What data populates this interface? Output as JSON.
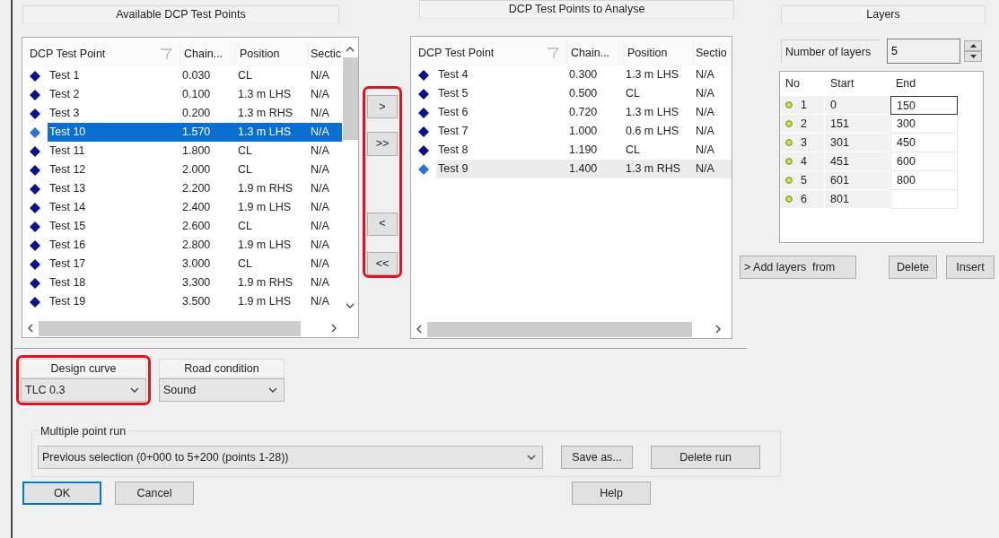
{
  "available": {
    "title": "Available DCP Test Points",
    "columns": [
      "DCP Test Point",
      "Chain...",
      "Position",
      "Sectic"
    ],
    "rows": [
      {
        "name": "Test 1",
        "chainage": "0.030",
        "position": "CL",
        "section": "N/A",
        "selected": false
      },
      {
        "name": "Test 2",
        "chainage": "0.100",
        "position": "1.3 m LHS",
        "section": "N/A",
        "selected": false
      },
      {
        "name": "Test 3",
        "chainage": "0.200",
        "position": "1.3 m RHS",
        "section": "N/A",
        "selected": false
      },
      {
        "name": "Test 10",
        "chainage": "1.570",
        "position": "1.3 m LHS",
        "section": "N/A",
        "selected": true
      },
      {
        "name": "Test 11",
        "chainage": "1.800",
        "position": "CL",
        "section": "N/A",
        "selected": false
      },
      {
        "name": "Test 12",
        "chainage": "2.000",
        "position": "CL",
        "section": "N/A",
        "selected": false
      },
      {
        "name": "Test 13",
        "chainage": "2.200",
        "position": "1.9 m RHS",
        "section": "N/A",
        "selected": false
      },
      {
        "name": "Test 14",
        "chainage": "2.400",
        "position": "1.9 m LHS",
        "section": "N/A",
        "selected": false
      },
      {
        "name": "Test 15",
        "chainage": "2.600",
        "position": "CL",
        "section": "N/A",
        "selected": false
      },
      {
        "name": "Test 16",
        "chainage": "2.800",
        "position": "1.9 m LHS",
        "section": "N/A",
        "selected": false
      },
      {
        "name": "Test 17",
        "chainage": "3.000",
        "position": "CL",
        "section": "N/A",
        "selected": false
      },
      {
        "name": "Test 18",
        "chainage": "3.300",
        "position": "1.9 m RHS",
        "section": "N/A",
        "selected": false
      },
      {
        "name": "Test 19",
        "chainage": "3.500",
        "position": "1.9 m LHS",
        "section": "N/A",
        "selected": false
      }
    ]
  },
  "transfer_buttons": {
    "highlighted": true,
    "buttons": [
      ">",
      ">>",
      "<",
      "<<"
    ]
  },
  "to_analyse": {
    "title": "DCP Test Points to Analyse",
    "columns": [
      "DCP Test Point",
      "Chain...",
      "Position",
      "Sectio"
    ],
    "rows": [
      {
        "name": "Test 4",
        "chainage": "0.300",
        "position": "1.3 m LHS",
        "section": "N/A",
        "selected": false
      },
      {
        "name": "Test 5",
        "chainage": "0.500",
        "position": "CL",
        "section": "N/A",
        "selected": false
      },
      {
        "name": "Test 6",
        "chainage": "0.720",
        "position": "1.3 m LHS",
        "section": "N/A",
        "selected": false
      },
      {
        "name": "Test 7",
        "chainage": "1.000",
        "position": "0.6 m LHS",
        "section": "N/A",
        "selected": false
      },
      {
        "name": "Test 8",
        "chainage": "1.190",
        "position": "CL",
        "section": "N/A",
        "selected": false
      },
      {
        "name": "Test 9",
        "chainage": "1.400",
        "position": "1.3 m RHS",
        "section": "N/A",
        "selected": true
      }
    ]
  },
  "layers": {
    "title": "Layers",
    "count_label": "Number of layers",
    "count": "5",
    "columns": [
      "No",
      "Start",
      "End"
    ],
    "rows": [
      {
        "no": "1",
        "start": "0",
        "end": "150",
        "editing": true
      },
      {
        "no": "2",
        "start": "151",
        "end": "300",
        "editing": false
      },
      {
        "no": "3",
        "start": "301",
        "end": "450",
        "editing": false
      },
      {
        "no": "4",
        "start": "451",
        "end": "600",
        "editing": false
      },
      {
        "no": "5",
        "start": "601",
        "end": "800",
        "editing": false
      },
      {
        "no": "6",
        "start": "801",
        "editing": false
      }
    ],
    "add_button": "> Add layers  from",
    "delete_button": "Delete",
    "insert_button": "Insert"
  },
  "design_curve": {
    "label": "Design curve",
    "value": "TLC 0.3",
    "highlighted": true
  },
  "road_condition": {
    "label": "Road condition",
    "value": "Sound"
  },
  "multiple_point_run": {
    "label": "Multiple point run",
    "value": "Previous selection (0+000 to 5+200 (points 1-28))",
    "save_button": "Save as...",
    "delete_button": "Delete run"
  },
  "buttons": [
    {
      "label": "OK",
      "default": true
    },
    {
      "label": "Cancel",
      "default": false
    },
    {
      "label": "Help",
      "default": false
    }
  ]
}
